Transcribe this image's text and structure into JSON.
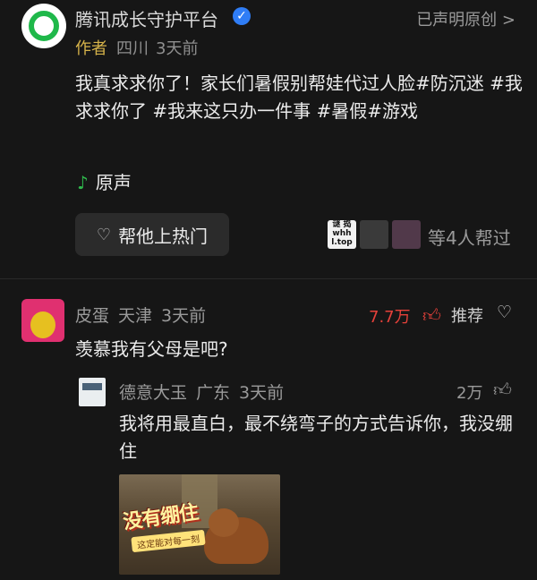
{
  "post": {
    "author_name": "腾讯成长守护平台",
    "declared": "已声明原创 >",
    "author_tag": "作者",
    "location": "四川",
    "time": "3天前",
    "text": "我真求求你了！家长们暑假别帮娃代过人脸#防沉迷 #我求求你了 #我来这只办一件事 #暑假#游戏",
    "sound": "原声",
    "hot_button": "帮他上热门",
    "helper_1_text": "谜 捣 whh l.top",
    "helpers_text": "等4人帮过"
  },
  "comment": {
    "name": "皮蛋",
    "location": "天津",
    "time": "3天前",
    "likes": "7.7万",
    "recommend": "推荐",
    "text": "羡慕我有父母是吧?"
  },
  "reply": {
    "name": "德意大玉",
    "location": "广东",
    "time": "3天前",
    "likes": "2万",
    "text": "我将用最直白，最不绕弯子的方式告诉你，我没绷住",
    "meme_title": "没有绷住",
    "meme_subtitle": "这定能对每一刻"
  },
  "icons": {
    "verified": "verified-check-icon",
    "music": "music-note-icon",
    "heart_fire": "heart-icon",
    "thumb": "thumb-up-icon",
    "heart_outline": "heart-outline-icon"
  },
  "colors": {
    "background": "#161616",
    "green": "#1fb84a",
    "likes_red": "#e5413a",
    "author_tag": "#d6b34a",
    "verified_blue": "#2f7df6"
  }
}
